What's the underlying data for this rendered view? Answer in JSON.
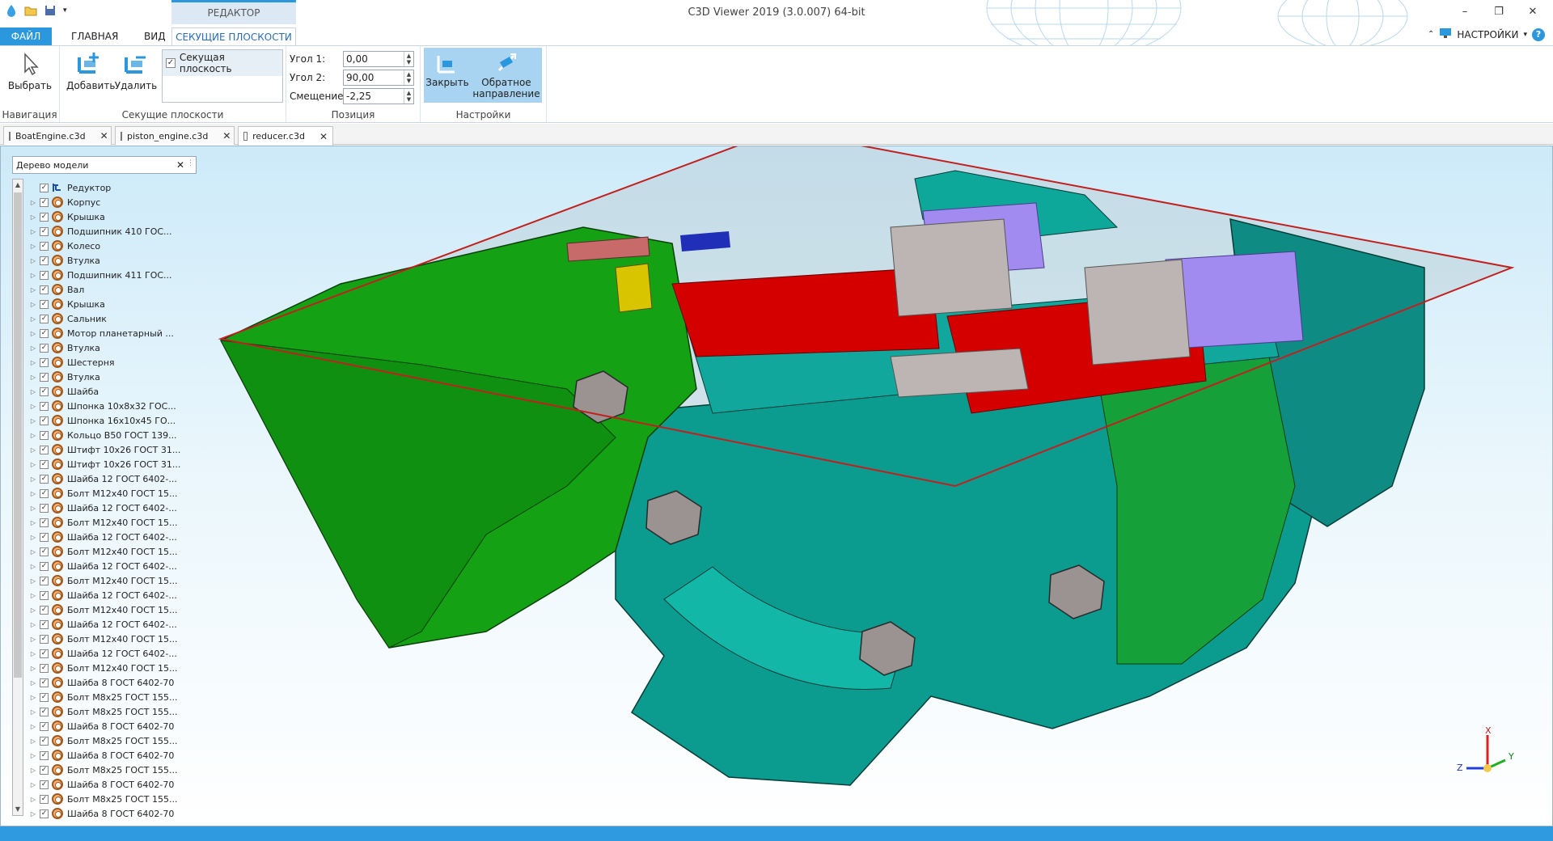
{
  "window": {
    "title": "C3D Viewer 2019 (3.0.007) 64-bit",
    "controls": {
      "minimize": "–",
      "maximize": "❐",
      "close": "✕"
    }
  },
  "ribbon_tabs": {
    "file": "ФАЙЛ",
    "main": "ГЛАВНАЯ",
    "view": "ВИД",
    "editor_group": "РЕДАКТОР",
    "sections": "СЕКУЩИЕ ПЛОСКОСТИ",
    "settings": "НАСТРОЙКИ",
    "help": "?"
  },
  "ribbon": {
    "navigation": {
      "group_label": "Навигация",
      "select_label": "Выбрать"
    },
    "sections": {
      "group_label": "Секущие плоскости",
      "add_label": "Добавить",
      "delete_label": "Удалить",
      "list_item": "Секущая плоскость",
      "list_item_checked": true
    },
    "position": {
      "group_label": "Позиция",
      "angle1_label": "Угол 1:",
      "angle1_value": "0,00",
      "angle2_label": "Угол 2:",
      "angle2_value": "90,00",
      "offset_label": "Смещение:",
      "offset_value": "-2,25"
    },
    "settings": {
      "group_label": "Настройки",
      "close_label": "Закрыть",
      "reverse_label_1": "Обратное",
      "reverse_label_2": "направление"
    }
  },
  "doc_tabs": [
    {
      "label": "BoatEngine.c3d"
    },
    {
      "label": "piston_engine.c3d"
    },
    {
      "label": "reducer.c3d",
      "active": true
    }
  ],
  "tree": {
    "header": "Дерево модели",
    "root": "Редуктор",
    "items": [
      "Корпус",
      "Крышка",
      "Подшипник 410 ГОС...",
      "Колесо",
      "Втулка",
      "Подшипник 411 ГОС...",
      "Вал",
      "Крышка",
      "Сальник",
      "Мотор планетарный ...",
      "Втулка",
      "Шестерня",
      "Втулка",
      "Шайба",
      "Шпонка 10x8x32 ГОС...",
      "Шпонка 16x10x45 ГО...",
      "Кольцо B50 ГОСТ 139...",
      "Штифт 10x26 ГОСТ 31...",
      "Штифт 10x26 ГОСТ 31...",
      "Шайба 12 ГОСТ 6402-...",
      "Болт M12x40 ГОСТ 15...",
      "Шайба 12 ГОСТ 6402-...",
      "Болт M12x40 ГОСТ 15...",
      "Шайба 12 ГОСТ 6402-...",
      "Болт M12x40 ГОСТ 15...",
      "Шайба 12 ГОСТ 6402-...",
      "Болт M12x40 ГОСТ 15...",
      "Шайба 12 ГОСТ 6402-...",
      "Болт M12x40 ГОСТ 15...",
      "Шайба 12 ГОСТ 6402-...",
      "Болт M12x40 ГОСТ 15...",
      "Шайба 12 ГОСТ 6402-...",
      "Болт M12x40 ГОСТ 15...",
      "Шайба 8 ГОСТ 6402-70",
      "Болт M8x25 ГОСТ 155...",
      "Болт M8x25 ГОСТ 155...",
      "Шайба 8 ГОСТ 6402-70",
      "Болт M8x25 ГОСТ 155...",
      "Шайба 8 ГОСТ 6402-70",
      "Болт M8x25 ГОСТ 155...",
      "Шайба 8 ГОСТ 6402-70",
      "Болт M8x25 ГОСТ 155...",
      "Шайба 8 ГОСТ 6402-70"
    ]
  },
  "axes": {
    "x": "X",
    "y": "Y",
    "z": "Z"
  },
  "colors": {
    "accent": "#2b97dd",
    "housing_teal": "#0d9a8e",
    "housing_green": "#12a112",
    "gear_red": "#d40000",
    "section_plane": "#c21f1f"
  }
}
